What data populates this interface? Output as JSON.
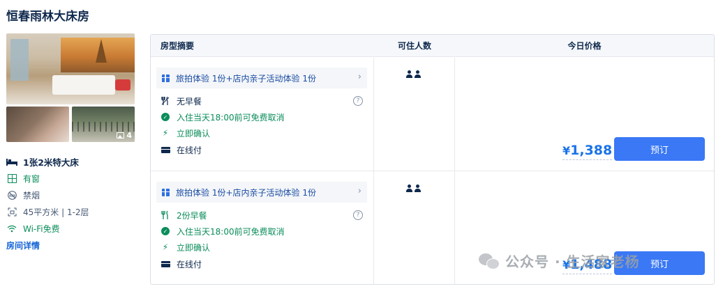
{
  "room": {
    "title": "恒春雨林大床房",
    "photo_count": "4",
    "bed": "1张2米特大床",
    "window": "有窗",
    "smoking": "禁烟",
    "size_floor": "45平方米 | 1-2层",
    "wifi": "Wi-Fi免费",
    "details_link": "房间详情"
  },
  "table": {
    "headers": [
      "房型摘要",
      "可住人数",
      "今日价格"
    ]
  },
  "offers": [
    {
      "promo": "旅拍体验 1份+店内亲子活动体验 1份",
      "meal": "无早餐",
      "cancel": "入住当天18:00前可免费取消",
      "confirm": "立即确认",
      "payment": "在线付",
      "occupancy": 2,
      "price": "1,388",
      "currency": "¥",
      "book_label": "预订"
    },
    {
      "promo": "旅拍体验 1份+店内亲子活动体验 1份",
      "meal": "2份早餐",
      "cancel": "入住当天18:00前可免费取消",
      "confirm": "立即确认",
      "payment": "在线付",
      "occupancy": 2,
      "price": "1,488",
      "currency": "¥",
      "book_label": "预订"
    }
  ],
  "watermark": {
    "text": "公众号 · 生活家老杨"
  },
  "colors": {
    "accent": "#3a78f5",
    "price": "#1a73e8",
    "green": "#0a8d5a",
    "text": "#0f294d"
  },
  "icons": [
    "bed-icon",
    "window-icon",
    "no-smoking-icon",
    "area-icon",
    "wifi-icon",
    "gift-icon",
    "chevron-right-icon",
    "utensils-icon",
    "check-circle-icon",
    "bolt-icon",
    "card-icon",
    "help-icon",
    "person-icon",
    "image-icon"
  ]
}
